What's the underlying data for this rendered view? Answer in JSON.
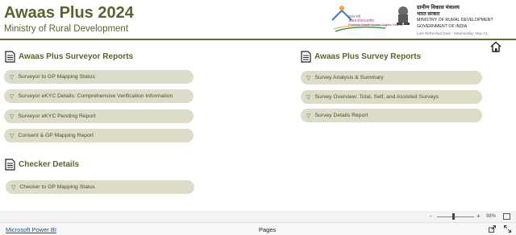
{
  "header": {
    "title": "Awaas Plus 2024",
    "subtitle": "Ministry of Rural Development",
    "pmay_logo_text_1": "प्रधान मंत्री",
    "pmay_logo_text_2": "आवास योजना-ग्रामीण",
    "pmay_logo_text_3": "Pradhan Mantri Awaas Yojana-Gramin",
    "ministry_hindi": "ग्रामीण विकास मंत्रालय",
    "govt_hindi": "भारत सरकार",
    "ministry_en": "MINISTRY OF RURAL DEVELOPMENT",
    "govt_en": "GOVERNMENT OF INDIA",
    "last_refreshed": "Last Refreshed Date : Wednesday, May 21,"
  },
  "surveyor_reports": {
    "title": "Awaas Plus Surveyor Reports",
    "items": [
      "Surveyor to GP Mapping Status",
      "Surveyor eKYC Details: Comprehensive Verification Information",
      "Surveyor eKYC Pending Report",
      "Consent & GP Mapping Report"
    ]
  },
  "checker_details": {
    "title": "Checker Details",
    "items": [
      "Checker to GP Mapping Status"
    ]
  },
  "survey_reports": {
    "title": "Awaas Plus Survey Reports",
    "items": [
      "Survey Analysis & Summary",
      "Survey Overview: Total, Self, and Assisted Surveys",
      "Survey Details Report"
    ]
  },
  "statusbar": {
    "zoom_minus": "-",
    "zoom_plus": "+",
    "zoom": "98%"
  },
  "footer": {
    "powerbi_link": "Microsoft Power BI",
    "pages": "Pages"
  },
  "icons": {
    "home": "home-icon",
    "document": "document-icon",
    "triangle": "triangle-down-icon",
    "share": "share-icon",
    "expand": "expand-icon"
  },
  "colors": {
    "accent": "#5a6330",
    "pill": "#dcdcc8",
    "link": "#1a4f8a"
  }
}
